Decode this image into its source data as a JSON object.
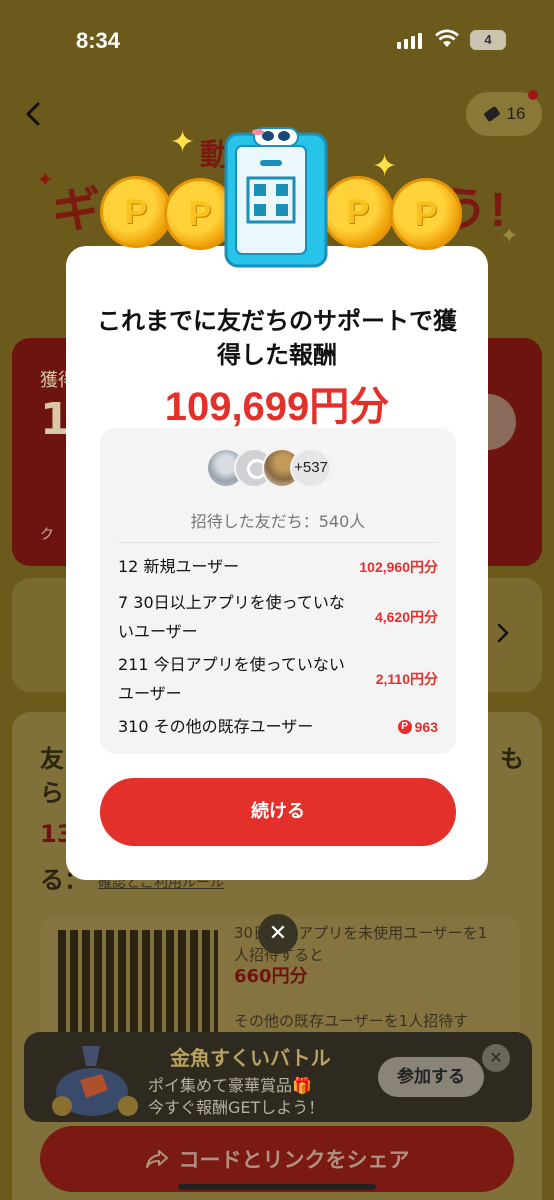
{
  "status_bar": {
    "time": "8:34",
    "battery": "4"
  },
  "header": {
    "ticket_count": "16"
  },
  "background": {
    "hero_title": "ギ",
    "hero_title_end": "う!",
    "hero_small": "動",
    "earn_label": "獲得",
    "earn_big": "1",
    "earn_footer": "ク",
    "invite_heading_1": "友",
    "invite_heading_2": "ら",
    "invite_heading_right_1": "も",
    "invite_number": "13",
    "invite_ru": "る：",
    "invite_link": "確認とご利用ルール",
    "rule_1": "30日以上アプリを未使用ユーザーを1人招待すると",
    "rule_1_amount": "660円分",
    "rule_2": "その他の既存ユーザーを1人招待す"
  },
  "banner": {
    "title": "金魚すくいバトル",
    "line1": "ポイ集めて豪華賞品🎁",
    "line2": "今すぐ報酬GETしよう！",
    "join_label": "参加する"
  },
  "share_button": "コードとリンクをシェア",
  "modal": {
    "title": "これまでに友だちのサポートで獲得した報酬",
    "amount": "109,699円分",
    "avatar_more": "+537",
    "invited_summary": "招待した友だち：540人",
    "rows": [
      {
        "label": "12 新規ユーザー",
        "value": "102,960円分",
        "badge": ""
      },
      {
        "label": "7 30日以上アプリを使っていないユーザー",
        "value": "4,620円分",
        "badge": ""
      },
      {
        "label": "211 今日アプリを使っていないユーザー",
        "value": "2,110円分",
        "badge": ""
      },
      {
        "label": "310 その他の既存ユーザー",
        "value": "963",
        "badge": "P"
      }
    ],
    "continue_label": "続ける"
  },
  "colors": {
    "accent_red": "#e3302b",
    "modal_bg": "#ffffff",
    "stats_bg": "#f4f4f5"
  }
}
